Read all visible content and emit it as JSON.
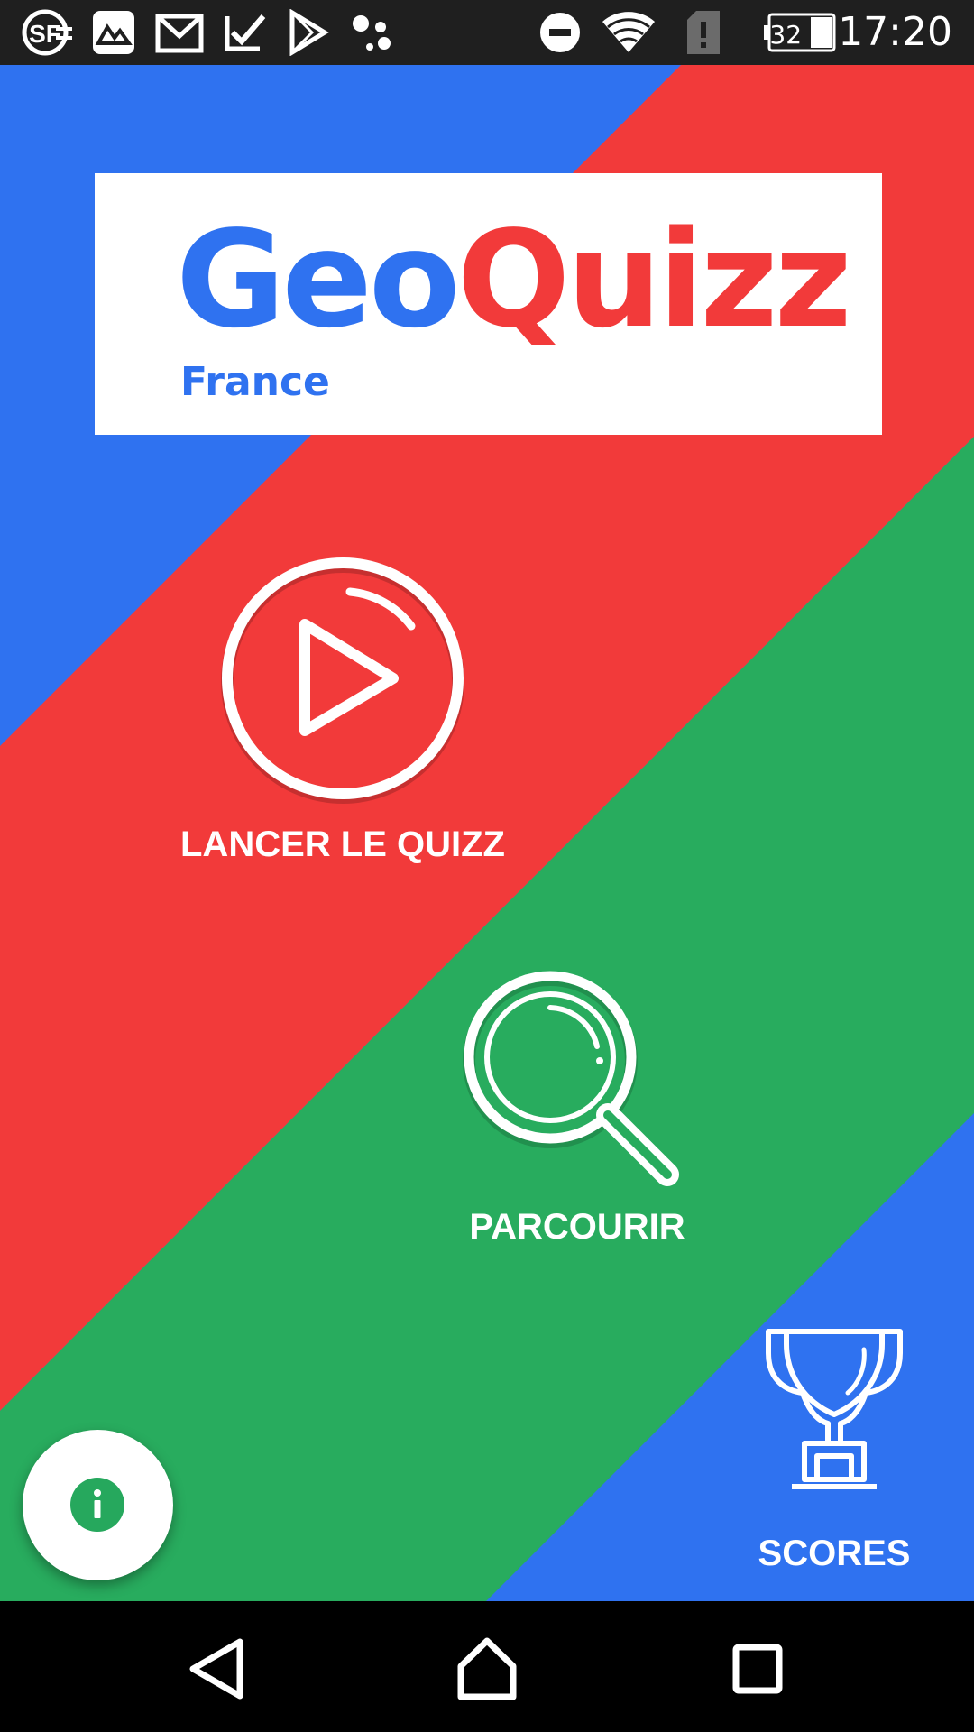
{
  "status_bar": {
    "time": "17:20",
    "battery": "32 %",
    "icons": [
      "sf-icon",
      "gallery-icon",
      "gmail-icon",
      "tasks-check-icon",
      "play-store-icon",
      "assistant-icon",
      "do-not-disturb-icon",
      "wifi-icon",
      "sim-alert-icon",
      "battery-icon"
    ]
  },
  "logo": {
    "part1": "Geo",
    "part2": "Quizz",
    "subtitle": "France"
  },
  "menu": {
    "play_label": "LANCER LE QUIZZ",
    "browse_label": "PARCOURIR",
    "scores_label": "SCORES"
  },
  "fab": {
    "icon": "info-icon"
  },
  "nav": {
    "icons": [
      "back-icon",
      "home-icon",
      "recents-icon"
    ]
  },
  "colors": {
    "blue": "#2f72f0",
    "red": "#f23a3a",
    "green": "#28ac5e",
    "status_bar": "#1f1f1f",
    "nav_bar": "#000000"
  }
}
